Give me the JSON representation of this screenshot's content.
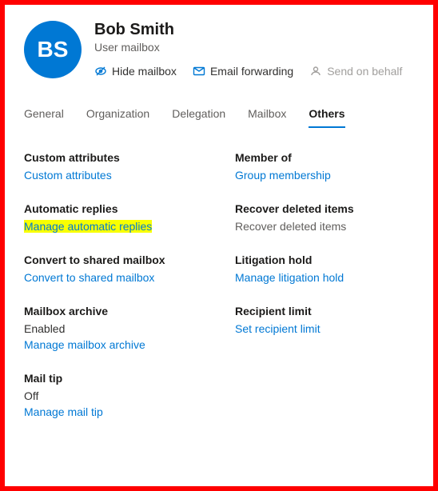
{
  "header": {
    "initials": "BS",
    "name": "Bob Smith",
    "subtitle": "User mailbox",
    "actions": {
      "hide_mailbox": "Hide mailbox",
      "email_forwarding": "Email forwarding",
      "send_on_behalf": "Send on behalf"
    }
  },
  "tabs": {
    "general": "General",
    "organization": "Organization",
    "delegation": "Delegation",
    "mailbox": "Mailbox",
    "others": "Others"
  },
  "left": {
    "custom_attributes": {
      "title": "Custom attributes",
      "link": "Custom attributes"
    },
    "automatic_replies": {
      "title": "Automatic replies",
      "link": "Manage automatic replies"
    },
    "convert_shared": {
      "title": "Convert to shared mailbox",
      "link": "Convert to shared mailbox"
    },
    "mailbox_archive": {
      "title": "Mailbox archive",
      "value": "Enabled",
      "link": "Manage mailbox archive"
    },
    "mail_tip": {
      "title": "Mail tip",
      "value": "Off",
      "link": "Manage mail tip"
    }
  },
  "right": {
    "member_of": {
      "title": "Member of",
      "link": "Group membership"
    },
    "recover_deleted": {
      "title": "Recover deleted items",
      "text": "Recover deleted items"
    },
    "litigation_hold": {
      "title": "Litigation hold",
      "link": "Manage litigation hold"
    },
    "recipient_limit": {
      "title": "Recipient limit",
      "link": "Set recipient limit"
    }
  }
}
